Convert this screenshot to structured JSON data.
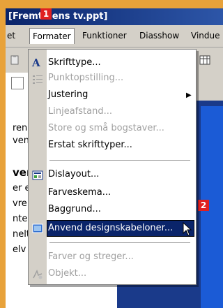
{
  "window": {
    "title": "[Fremtidens tv.ppt]"
  },
  "badges": {
    "one": "1",
    "two": "2"
  },
  "menubar": {
    "items": [
      {
        "label": "et"
      },
      {
        "label": "Formater"
      },
      {
        "label": "Funktioner"
      },
      {
        "label": "Diasshow"
      },
      {
        "label": "Vindue"
      }
    ]
  },
  "leftpane": {
    "lines": [
      "ren",
      "ven",
      "ver",
      "er e",
      "vre",
      "nter",
      "nelt",
      "elv"
    ]
  },
  "menu": {
    "items": [
      {
        "label": "Skrifttype...",
        "disabled": false
      },
      {
        "label": "Punktopstilling...",
        "disabled": true
      },
      {
        "label": "Justering",
        "disabled": false
      },
      {
        "label": "Linjeafstand...",
        "disabled": true
      },
      {
        "label": "Store og små bogstaver...",
        "disabled": true
      },
      {
        "label": "Erstat skrifttyper...",
        "disabled": false
      },
      {
        "label": "Dislayout...",
        "disabled": false
      },
      {
        "label": "Farveskema...",
        "disabled": false
      },
      {
        "label": "Baggrund...",
        "disabled": false
      },
      {
        "label": "Anvend designskabeloner...",
        "disabled": false
      },
      {
        "label": "Farver og streger...",
        "disabled": true
      },
      {
        "label": "Objekt...",
        "disabled": true
      }
    ]
  },
  "colors": {
    "titlebar": "#0A246A",
    "highlight": "#0A246A",
    "background": "#E8A23A"
  }
}
